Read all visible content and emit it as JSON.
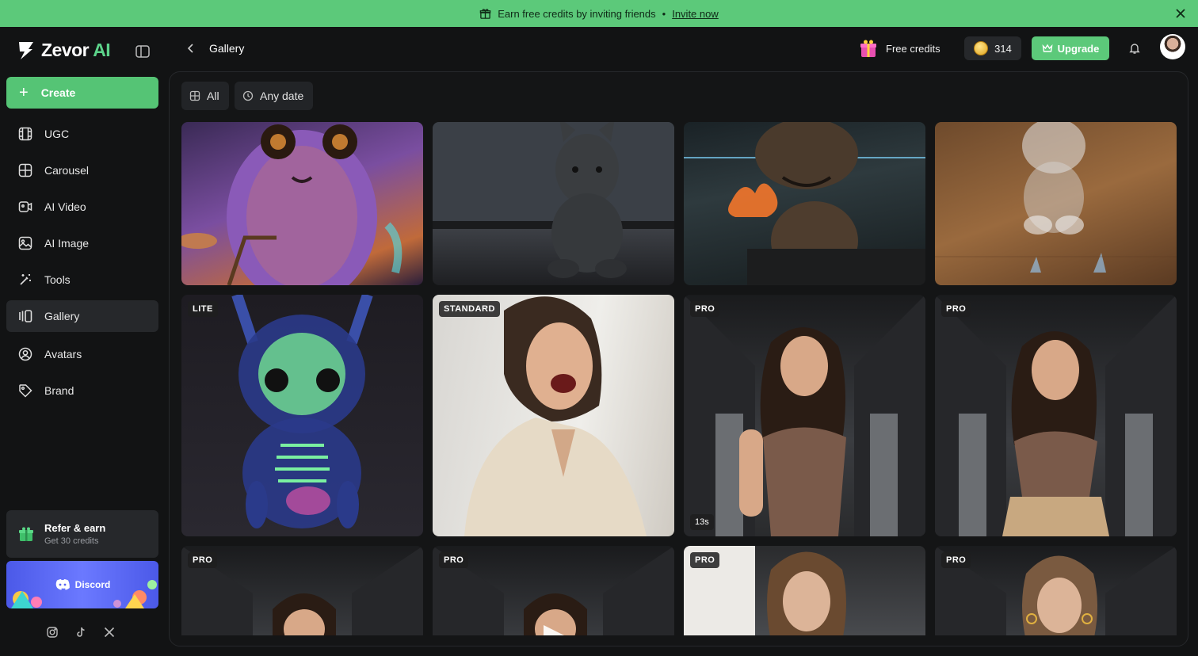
{
  "banner": {
    "text": "Earn free credits by inviting friends",
    "separator": "•",
    "link": "Invite now"
  },
  "brand": {
    "name": "Zevor",
    "suffix": "AI"
  },
  "sidebar": {
    "create_label": "Create",
    "items": [
      {
        "label": "UGC",
        "icon": "film-icon"
      },
      {
        "label": "Carousel",
        "icon": "grid-icon"
      },
      {
        "label": "AI Video",
        "icon": "video-icon"
      },
      {
        "label": "AI Image",
        "icon": "image-icon"
      },
      {
        "label": "Tools",
        "icon": "magic-wand-icon"
      },
      {
        "label": "Gallery",
        "icon": "gallery-icon"
      },
      {
        "label": "Avatars",
        "icon": "user-circle-icon"
      },
      {
        "label": "Brand",
        "icon": "tag-icon"
      }
    ],
    "refer": {
      "title": "Refer & earn",
      "subtitle": "Get 30 credits"
    },
    "discord_label": "Discord"
  },
  "header": {
    "title": "Gallery",
    "free_credits": "Free credits",
    "credits": "314",
    "upgrade": "Upgrade"
  },
  "filters": {
    "type": "All",
    "date": "Any date"
  },
  "gallery": [
    {
      "badge": "",
      "duration": ""
    },
    {
      "badge": "",
      "duration": ""
    },
    {
      "badge": "",
      "duration": ""
    },
    {
      "badge": "",
      "duration": ""
    },
    {
      "badge": "LITE",
      "duration": ""
    },
    {
      "badge": "STANDARD",
      "duration": ""
    },
    {
      "badge": "PRO",
      "duration": "13s"
    },
    {
      "badge": "PRO",
      "duration": ""
    },
    {
      "badge": "PRO",
      "duration": ""
    },
    {
      "badge": "PRO",
      "duration": ""
    },
    {
      "badge": "PRO",
      "duration": ""
    },
    {
      "badge": "PRO",
      "duration": ""
    }
  ],
  "colors": {
    "accent": "#5cc97a",
    "background": "#121314",
    "panel": "#26282b"
  }
}
